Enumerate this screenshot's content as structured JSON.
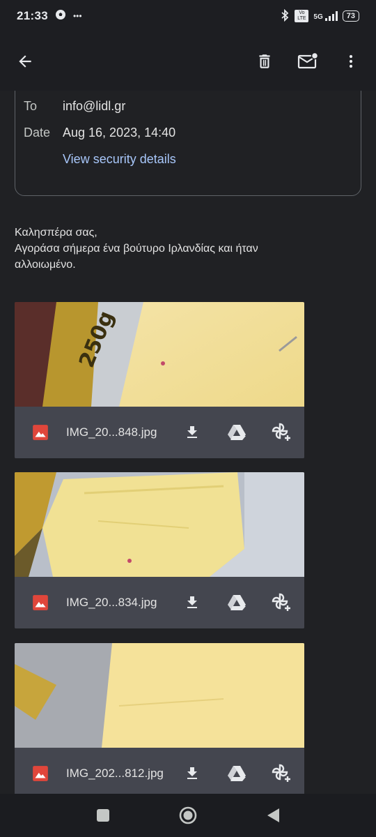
{
  "status_bar": {
    "time": "21:33",
    "dots": "•••",
    "network": "5G",
    "volte": "Vo LTE",
    "battery": "73"
  },
  "app_bar": {
    "back_icon": "arrow-back-icon",
    "delete_icon": "trash-icon",
    "mark_unread_icon": "mail-unread-icon",
    "more_icon": "more-vert-icon"
  },
  "details": {
    "to_label": "To",
    "to_value": "info@lidl.gr",
    "date_label": "Date",
    "date_value": "Aug 16, 2023, 14:40",
    "security_link": "View security details"
  },
  "body": {
    "greeting": "Καλησπέρα σας,",
    "line1": "Αγοράσα σήμερα ένα βούτυρο Ιρλανδίας και ήταν",
    "line2": "αλλοιωμένο."
  },
  "attachments": [
    {
      "filename": "IMG_20...848.jpg"
    },
    {
      "filename": "IMG_20...834.jpg"
    },
    {
      "filename": "IMG_202...812.jpg"
    }
  ],
  "colors": {
    "background": "#202124",
    "link": "#a8c7fa",
    "attachment_bar": "#44464f",
    "image_icon": "#e0463b"
  }
}
